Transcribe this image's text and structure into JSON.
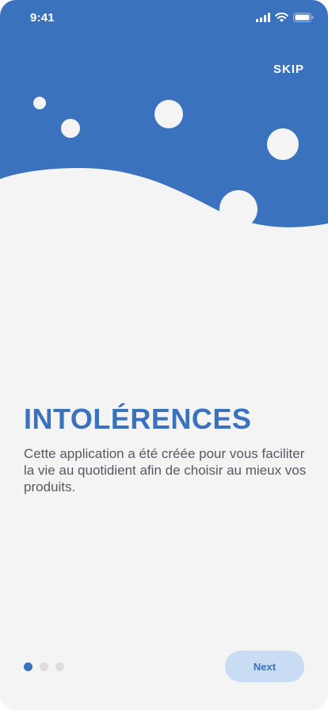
{
  "status_bar": {
    "time": "9:41",
    "icons": [
      "signal-icon",
      "wifi-icon",
      "battery-icon"
    ]
  },
  "header": {
    "skip_label": "SKIP",
    "bubble_color": "#f4f4f4",
    "background_color": "#3a72be"
  },
  "content": {
    "title": "INTOLÉRENCES",
    "description": "Cette application a été créée pour vous faciliter la vie au quotidient afin de choisir au mieux vos produits."
  },
  "pagination": {
    "total": 3,
    "active_index": 0
  },
  "footer": {
    "next_label": "Next"
  },
  "colors": {
    "primary": "#3a72be",
    "background": "#f4f4f4",
    "button_bg": "#c8dcf4",
    "text_secondary": "#555a60",
    "dot_inactive": "#dcdcdc"
  }
}
